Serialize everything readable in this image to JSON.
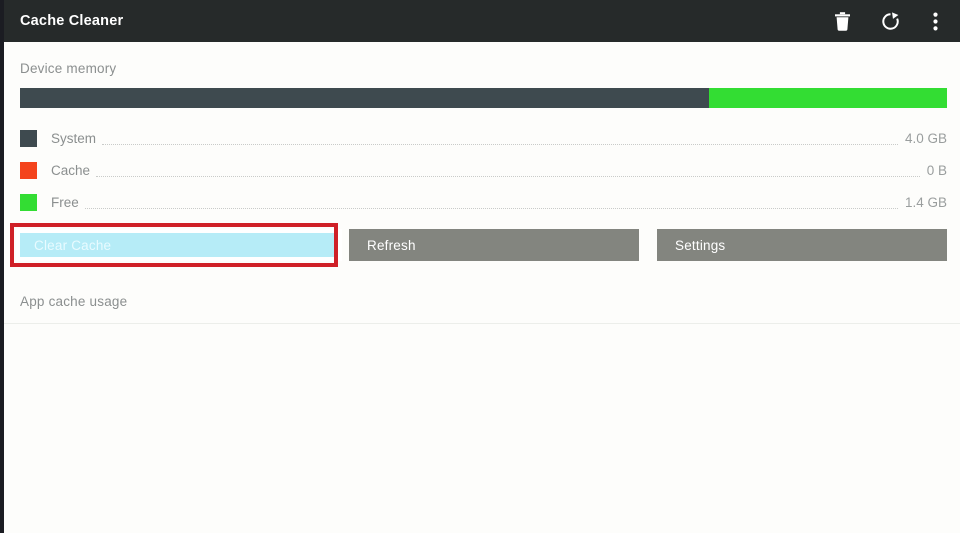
{
  "appbar": {
    "title": "Cache Cleaner",
    "actions": [
      {
        "name": "delete-icon",
        "label": "Delete"
      },
      {
        "name": "refresh-icon",
        "label": "Refresh"
      },
      {
        "name": "overflow-menu-icon",
        "label": "More options"
      }
    ]
  },
  "device_memory": {
    "label": "Device memory",
    "bar": {
      "segments": [
        {
          "key": "system",
          "color": "#3e4a4f",
          "percent": 74.3
        },
        {
          "key": "free",
          "color": "#33dd33",
          "percent": 25.7
        }
      ]
    },
    "legend": [
      {
        "name": "System",
        "value": "4.0 GB",
        "color": "#3e4a4f"
      },
      {
        "name": "Cache",
        "value": "0 B",
        "color": "#f4431c"
      },
      {
        "name": "Free",
        "value": "1.4 GB",
        "color": "#33dd33"
      }
    ]
  },
  "actions": {
    "clear_cache": "Clear Cache",
    "refresh": "Refresh",
    "settings": "Settings"
  },
  "app_cache": {
    "label": "App cache usage",
    "items": []
  },
  "colors": {
    "appbar_background": "#262a2a",
    "page_background": "#fdfdfb",
    "button_background": "#83857f",
    "highlight_fill": "#b6ecf7",
    "focus_outline": "#cf2027",
    "system": "#3e4a4f",
    "cache": "#f4431c",
    "free": "#33dd33"
  }
}
